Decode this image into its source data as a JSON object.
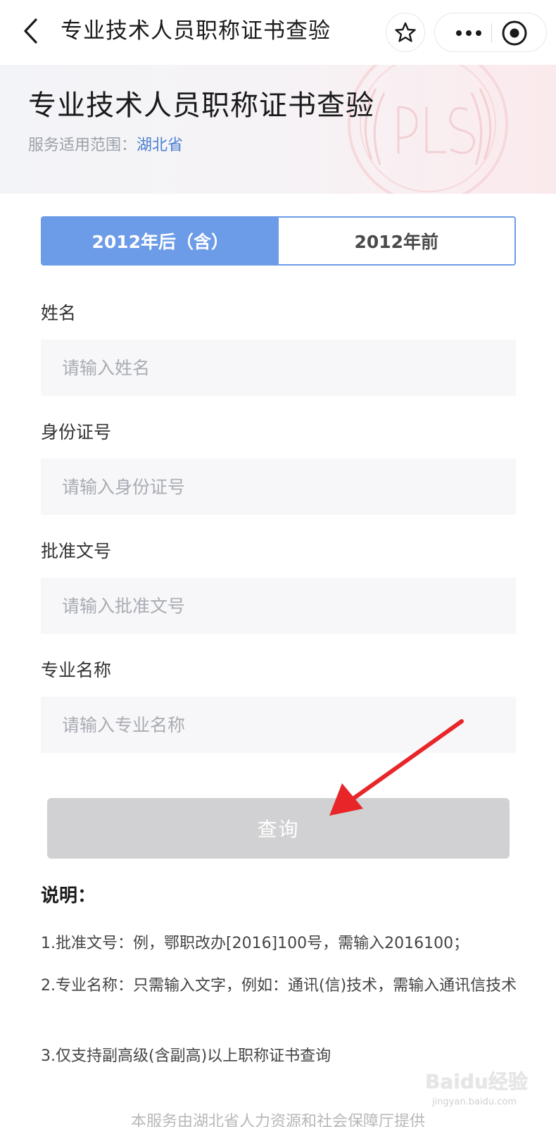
{
  "navbar": {
    "title": "专业技术人员职称证书查验"
  },
  "hero": {
    "title": "专业技术人员职称证书查验",
    "scope_label": "服务适用范围：",
    "scope_region": "湖北省"
  },
  "tabs": [
    {
      "label": "2012年后（含）",
      "active": true
    },
    {
      "label": "2012年前",
      "active": false
    }
  ],
  "form": {
    "fields": [
      {
        "label": "姓名",
        "placeholder": "请输入姓名",
        "value": ""
      },
      {
        "label": "身份证号",
        "placeholder": "请输入身份证号",
        "value": ""
      },
      {
        "label": "批准文号",
        "placeholder": "请输入批准文号",
        "value": ""
      },
      {
        "label": "专业名称",
        "placeholder": "请输入专业名称",
        "value": ""
      }
    ],
    "submit_label": "查询"
  },
  "notes": {
    "title": "说明：",
    "items": [
      "1.批准文号：例，鄂职改办[2016]100号，需输入2016100；",
      "2.专业名称：只需输入文字，例如：通讯(信)技术，需输入通讯信技术",
      "3.仅支持副高级(含副高)以上职称证书查询"
    ]
  },
  "footer": {
    "text": "本服务由湖北省人力资源和社会保障厅提供"
  },
  "watermark": {
    "logo": "Baidu经验",
    "url": "jingyan.baidu.com"
  },
  "colors": {
    "accent": "#6c9be8",
    "region_link": "#4a7fd0",
    "button_disabled": "#d1d1d3",
    "annotation_arrow": "#e8262a"
  },
  "icons": [
    "back-icon",
    "star-icon",
    "more-icon",
    "target-icon",
    "arrow-annotation"
  ]
}
